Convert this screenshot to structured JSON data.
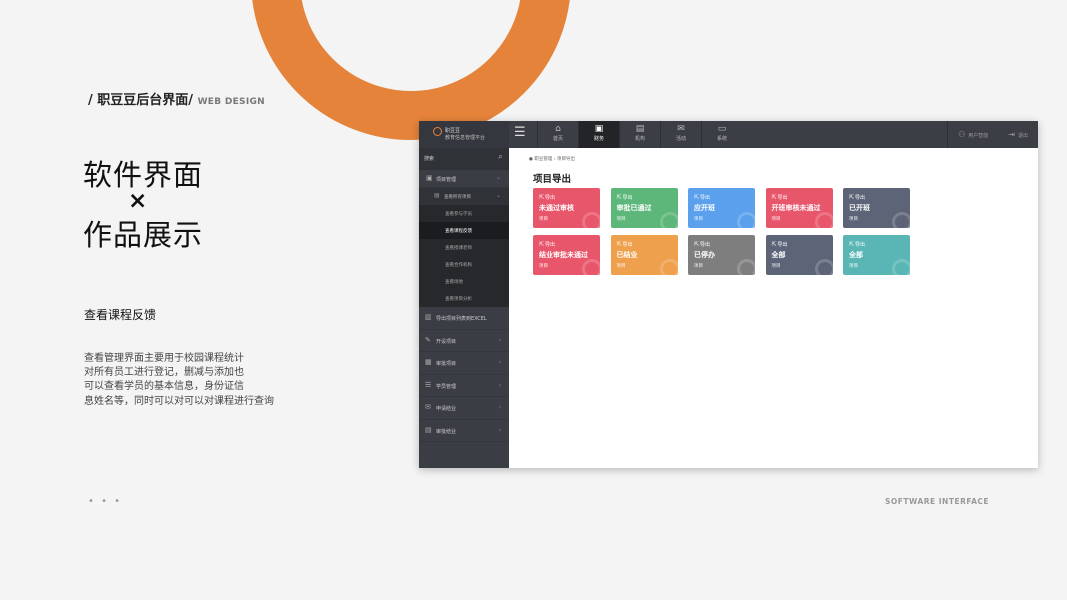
{
  "slide": {
    "header_title": "/  职豆豆后台界面/",
    "header_en": "WEB DESIGN",
    "heading_line1": "软件界面",
    "heading_cross": "×",
    "heading_line2": "作品展示",
    "subheading": "查看课程反馈",
    "description": [
      "查看管理界面主要用于校园课程统计",
      "对所有员工进行登记，删减与添加也",
      "可以查看学员的基本信息，身份证信",
      "息姓名等，同时可以对可以对课程进行查询"
    ],
    "dots": "• • •",
    "footer": "SOFTWARE INTERFACE",
    "accent_color": "#e5833a"
  },
  "app": {
    "logo": {
      "name": "职豆豆",
      "subtitle": "教育信息管理平台"
    },
    "menu_icon": "hamburger-icon",
    "nav": [
      {
        "label": "首页",
        "icon": "home-icon",
        "glyph": "⌂",
        "active": false
      },
      {
        "label": "财务",
        "icon": "wallet-icon",
        "glyph": "▣",
        "active": true
      },
      {
        "label": "机构",
        "icon": "building-icon",
        "glyph": "▤",
        "active": false
      },
      {
        "label": "活动",
        "icon": "mail-icon",
        "glyph": "✉",
        "active": false
      },
      {
        "label": "系统",
        "icon": "monitor-icon",
        "glyph": "▭",
        "active": false
      }
    ],
    "top_right": [
      {
        "label": "用户智能",
        "icon": "user-icon",
        "glyph": "⚇"
      },
      {
        "label": "退出",
        "icon": "logout-icon",
        "glyph": "⇥"
      }
    ],
    "sidebar": {
      "search_label": "搜索",
      "group": {
        "label": "项目管理"
      },
      "sub": {
        "label": "查看所有项目"
      },
      "sub_items": [
        {
          "label": "查看参与学员",
          "active": false
        },
        {
          "label": "查看课程反馈",
          "active": true
        },
        {
          "label": "查看授课老师",
          "active": false
        },
        {
          "label": "查看合作机构",
          "active": false
        },
        {
          "label": "查看场地",
          "active": false
        },
        {
          "label": "查看项目分析",
          "active": false
        }
      ],
      "items": [
        {
          "label": "导出项目列表到EXCEL",
          "icon": "building-icon",
          "glyph": "▥",
          "chevron": false
        },
        {
          "label": "开设项目",
          "icon": "edit-icon",
          "glyph": "✎",
          "chevron": true
        },
        {
          "label": "审批项目",
          "icon": "approve-icon",
          "glyph": "▦",
          "chevron": true
        },
        {
          "label": "学员管理",
          "icon": "users-icon",
          "glyph": "☰",
          "chevron": true
        },
        {
          "label": "申请结业",
          "icon": "mail-icon",
          "glyph": "✉",
          "chevron": true
        },
        {
          "label": "审批结业",
          "icon": "document-icon",
          "glyph": "▤",
          "chevron": true
        }
      ]
    },
    "breadcrumb": "●  职豆管理  ›  项目导出",
    "page_title": "项目导出",
    "cards": [
      {
        "top": "导出",
        "title": "未通过审核",
        "bottom": "项目",
        "color": "#e8566b"
      },
      {
        "top": "导出",
        "title": "审批已通过",
        "bottom": "项目",
        "color": "#5db67a"
      },
      {
        "top": "导出",
        "title": "应开班",
        "bottom": "项目",
        "color": "#5aa0ec"
      },
      {
        "top": "导出",
        "title": "开班审核未通过",
        "bottom": "项目",
        "color": "#e8566b"
      },
      {
        "top": "导出",
        "title": "已开班",
        "bottom": "项目",
        "color": "#5d6477"
      },
      {
        "top": "导出",
        "title": "结业审批未通过",
        "bottom": "项目",
        "color": "#e8566b"
      },
      {
        "top": "导出",
        "title": "已结业",
        "bottom": "项目",
        "color": "#eea04c"
      },
      {
        "top": "导出",
        "title": "已停办",
        "bottom": "项目",
        "color": "#7e7e7e"
      },
      {
        "top": "导出",
        "title": "全部",
        "bottom": "项目",
        "color": "#5d6477"
      },
      {
        "top": "导出",
        "title": "全部",
        "bottom": "项目",
        "color": "#5ab6b4"
      }
    ]
  }
}
